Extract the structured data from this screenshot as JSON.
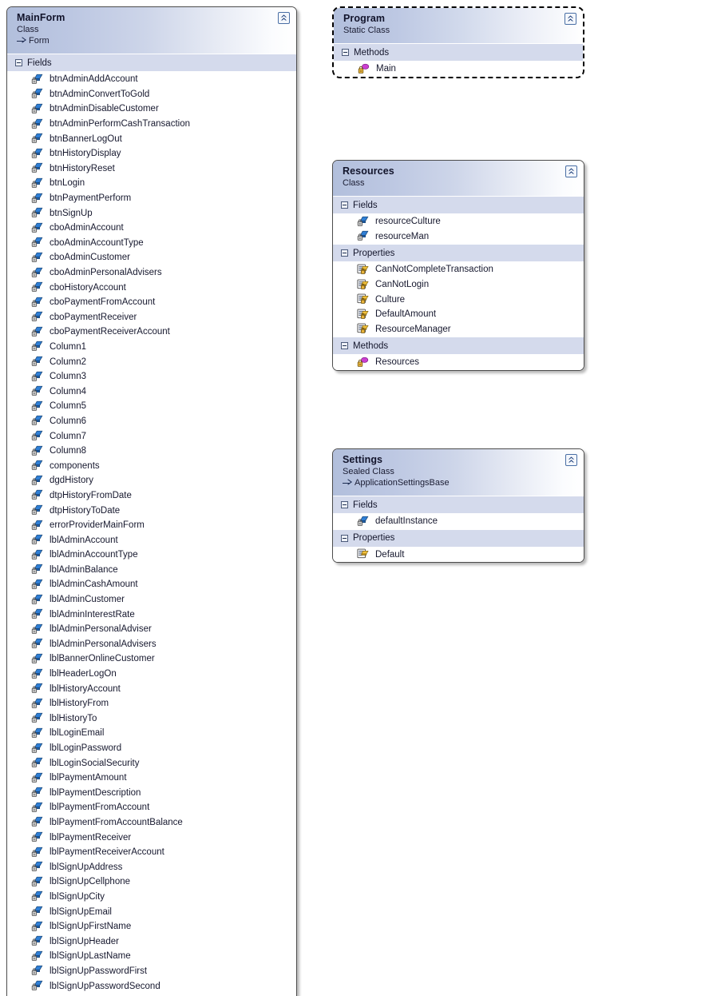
{
  "diagram": {
    "type": "class-diagram",
    "background": "#ffffff",
    "header_gradient_start": "#b2bfdc",
    "header_gradient_end": "#ffffff",
    "compartment_header_color": "#d4daec",
    "border_color": "#4c4c4c"
  },
  "shapes": [
    {
      "id": "mainform",
      "title": "MainForm",
      "kind": "Class",
      "base": "Form",
      "collapse_icon": "chevron-double-up-icon",
      "compartments": [
        {
          "name": "Fields",
          "expander_icon": "minus-box-icon",
          "members": [
            {
              "icon": "private-field-icon",
              "name": "btnAdminAddAccount"
            },
            {
              "icon": "private-field-icon",
              "name": "btnAdminConvertToGold"
            },
            {
              "icon": "private-field-icon",
              "name": "btnAdminDisableCustomer"
            },
            {
              "icon": "private-field-icon",
              "name": "btnAdminPerformCashTransaction"
            },
            {
              "icon": "private-field-icon",
              "name": "btnBannerLogOut"
            },
            {
              "icon": "private-field-icon",
              "name": "btnHistoryDisplay"
            },
            {
              "icon": "private-field-icon",
              "name": "btnHistoryReset"
            },
            {
              "icon": "private-field-icon",
              "name": "btnLogin"
            },
            {
              "icon": "private-field-icon",
              "name": "btnPaymentPerform"
            },
            {
              "icon": "private-field-icon",
              "name": "btnSignUp"
            },
            {
              "icon": "private-field-icon",
              "name": "cboAdminAccount"
            },
            {
              "icon": "private-field-icon",
              "name": "cboAdminAccountType"
            },
            {
              "icon": "private-field-icon",
              "name": "cboAdminCustomer"
            },
            {
              "icon": "private-field-icon",
              "name": "cboAdminPersonalAdvisers"
            },
            {
              "icon": "private-field-icon",
              "name": "cboHistoryAccount"
            },
            {
              "icon": "private-field-icon",
              "name": "cboPaymentFromAccount"
            },
            {
              "icon": "private-field-icon",
              "name": "cboPaymentReceiver"
            },
            {
              "icon": "private-field-icon",
              "name": "cboPaymentReceiverAccount"
            },
            {
              "icon": "private-field-icon",
              "name": "Column1"
            },
            {
              "icon": "private-field-icon",
              "name": "Column2"
            },
            {
              "icon": "private-field-icon",
              "name": "Column3"
            },
            {
              "icon": "private-field-icon",
              "name": "Column4"
            },
            {
              "icon": "private-field-icon",
              "name": "Column5"
            },
            {
              "icon": "private-field-icon",
              "name": "Column6"
            },
            {
              "icon": "private-field-icon",
              "name": "Column7"
            },
            {
              "icon": "private-field-icon",
              "name": "Column8"
            },
            {
              "icon": "private-field-icon",
              "name": "components"
            },
            {
              "icon": "private-field-icon",
              "name": "dgdHistory"
            },
            {
              "icon": "private-field-icon",
              "name": "dtpHistoryFromDate"
            },
            {
              "icon": "private-field-icon",
              "name": "dtpHistoryToDate"
            },
            {
              "icon": "private-field-icon",
              "name": "errorProviderMainForm"
            },
            {
              "icon": "private-field-icon",
              "name": "lblAdminAccount"
            },
            {
              "icon": "private-field-icon",
              "name": "lblAdminAccountType"
            },
            {
              "icon": "private-field-icon",
              "name": "lblAdminBalance"
            },
            {
              "icon": "private-field-icon",
              "name": "lblAdminCashAmount"
            },
            {
              "icon": "private-field-icon",
              "name": "lblAdminCustomer"
            },
            {
              "icon": "private-field-icon",
              "name": "lblAdminInterestRate"
            },
            {
              "icon": "private-field-icon",
              "name": "lblAdminPersonalAdviser"
            },
            {
              "icon": "private-field-icon",
              "name": "lblAdminPersonalAdvisers"
            },
            {
              "icon": "private-field-icon",
              "name": "lblBannerOnlineCustomer"
            },
            {
              "icon": "private-field-icon",
              "name": "lblHeaderLogOn"
            },
            {
              "icon": "private-field-icon",
              "name": "lblHistoryAccount"
            },
            {
              "icon": "private-field-icon",
              "name": "lblHistoryFrom"
            },
            {
              "icon": "private-field-icon",
              "name": "lblHistoryTo"
            },
            {
              "icon": "private-field-icon",
              "name": "lblLoginEmail"
            },
            {
              "icon": "private-field-icon",
              "name": "lblLoginPassword"
            },
            {
              "icon": "private-field-icon",
              "name": "lblLoginSocialSecurity"
            },
            {
              "icon": "private-field-icon",
              "name": "lblPaymentAmount"
            },
            {
              "icon": "private-field-icon",
              "name": "lblPaymentDescription"
            },
            {
              "icon": "private-field-icon",
              "name": "lblPaymentFromAccount"
            },
            {
              "icon": "private-field-icon",
              "name": "lblPaymentFromAccountBalance"
            },
            {
              "icon": "private-field-icon",
              "name": "lblPaymentReceiver"
            },
            {
              "icon": "private-field-icon",
              "name": "lblPaymentReceiverAccount"
            },
            {
              "icon": "private-field-icon",
              "name": "lblSignUpAddress"
            },
            {
              "icon": "private-field-icon",
              "name": "lblSignUpCellphone"
            },
            {
              "icon": "private-field-icon",
              "name": "lblSignUpCity"
            },
            {
              "icon": "private-field-icon",
              "name": "lblSignUpEmail"
            },
            {
              "icon": "private-field-icon",
              "name": "lblSignUpFirstName"
            },
            {
              "icon": "private-field-icon",
              "name": "lblSignUpHeader"
            },
            {
              "icon": "private-field-icon",
              "name": "lblSignUpLastName"
            },
            {
              "icon": "private-field-icon",
              "name": "lblSignUpPasswordFirst"
            },
            {
              "icon": "private-field-icon",
              "name": "lblSignUpPasswordSecond"
            }
          ]
        }
      ]
    },
    {
      "id": "program",
      "title": "Program",
      "kind": "Static Class",
      "base": null,
      "collapse_icon": "chevron-double-up-icon",
      "compartments": [
        {
          "name": "Methods",
          "expander_icon": "minus-box-icon",
          "members": [
            {
              "icon": "private-method-icon",
              "name": "Main"
            }
          ]
        }
      ]
    },
    {
      "id": "resources",
      "title": "Resources",
      "kind": "Class",
      "base": null,
      "collapse_icon": "chevron-double-up-icon",
      "compartments": [
        {
          "name": "Fields",
          "expander_icon": "minus-box-icon",
          "members": [
            {
              "icon": "private-field-icon",
              "name": "resourceCulture"
            },
            {
              "icon": "private-field-icon",
              "name": "resourceMan"
            }
          ]
        },
        {
          "name": "Properties",
          "expander_icon": "minus-box-icon",
          "members": [
            {
              "icon": "private-property-icon",
              "name": "CanNotCompleteTransaction"
            },
            {
              "icon": "private-property-icon",
              "name": "CanNotLogin"
            },
            {
              "icon": "private-property-icon",
              "name": "Culture"
            },
            {
              "icon": "private-property-icon",
              "name": "DefaultAmount"
            },
            {
              "icon": "private-property-icon",
              "name": "ResourceManager"
            }
          ]
        },
        {
          "name": "Methods",
          "expander_icon": "minus-box-icon",
          "members": [
            {
              "icon": "private-method-icon",
              "name": "Resources"
            }
          ]
        }
      ]
    },
    {
      "id": "settings",
      "title": "Settings",
      "kind": "Sealed Class",
      "base": "ApplicationSettingsBase",
      "collapse_icon": "chevron-double-up-icon",
      "compartments": [
        {
          "name": "Fields",
          "expander_icon": "minus-box-icon",
          "members": [
            {
              "icon": "private-field-icon",
              "name": "defaultInstance"
            }
          ]
        },
        {
          "name": "Properties",
          "expander_icon": "minus-box-icon",
          "members": [
            {
              "icon": "public-property-icon",
              "name": "Default"
            }
          ]
        }
      ]
    }
  ]
}
